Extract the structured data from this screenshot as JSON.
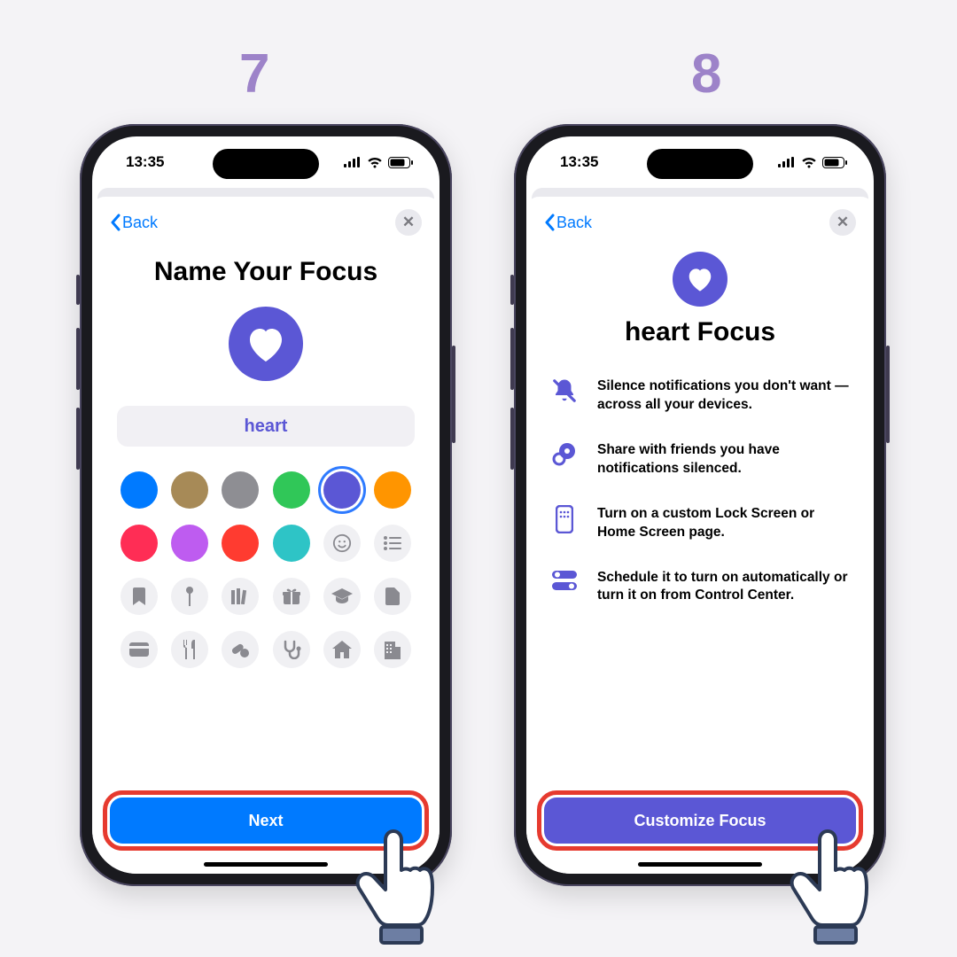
{
  "steps": {
    "left": "7",
    "right": "8"
  },
  "status": {
    "time": "13:35"
  },
  "common": {
    "back": "Back"
  },
  "screen7": {
    "title": "Name Your Focus",
    "focus_name": "heart",
    "colors": [
      {
        "hex": "#007aff",
        "name": "blue"
      },
      {
        "hex": "#a78a57",
        "name": "gold"
      },
      {
        "hex": "#8e8e93",
        "name": "gray"
      },
      {
        "hex": "#30c758",
        "name": "green"
      },
      {
        "hex": "#5b57d5",
        "name": "purple",
        "selected": true
      },
      {
        "hex": "#ff9500",
        "name": "orange"
      },
      {
        "hex": "#ff2d55",
        "name": "pink"
      },
      {
        "hex": "#be5cf0",
        "name": "violet"
      },
      {
        "hex": "#ff3b30",
        "name": "red"
      },
      {
        "hex": "#2ec4c6",
        "name": "teal"
      }
    ],
    "icons_row2": [
      "smiley",
      "list"
    ],
    "icons_row3": [
      "bookmark",
      "pin",
      "books",
      "gift",
      "graduation",
      "file"
    ],
    "icons_row4": [
      "credit-card",
      "fork-knife",
      "pills",
      "stethoscope",
      "house",
      "building"
    ],
    "next_button": "Next"
  },
  "screen8": {
    "title": "heart Focus",
    "features": [
      "Silence notifications you don't want — across all your devices.",
      "Share with friends you have notifications silenced.",
      "Turn on a custom Lock Screen or Home Screen page.",
      "Schedule it to turn on automatically or turn it on from Control Center."
    ],
    "customize_button": "Customize Focus"
  }
}
